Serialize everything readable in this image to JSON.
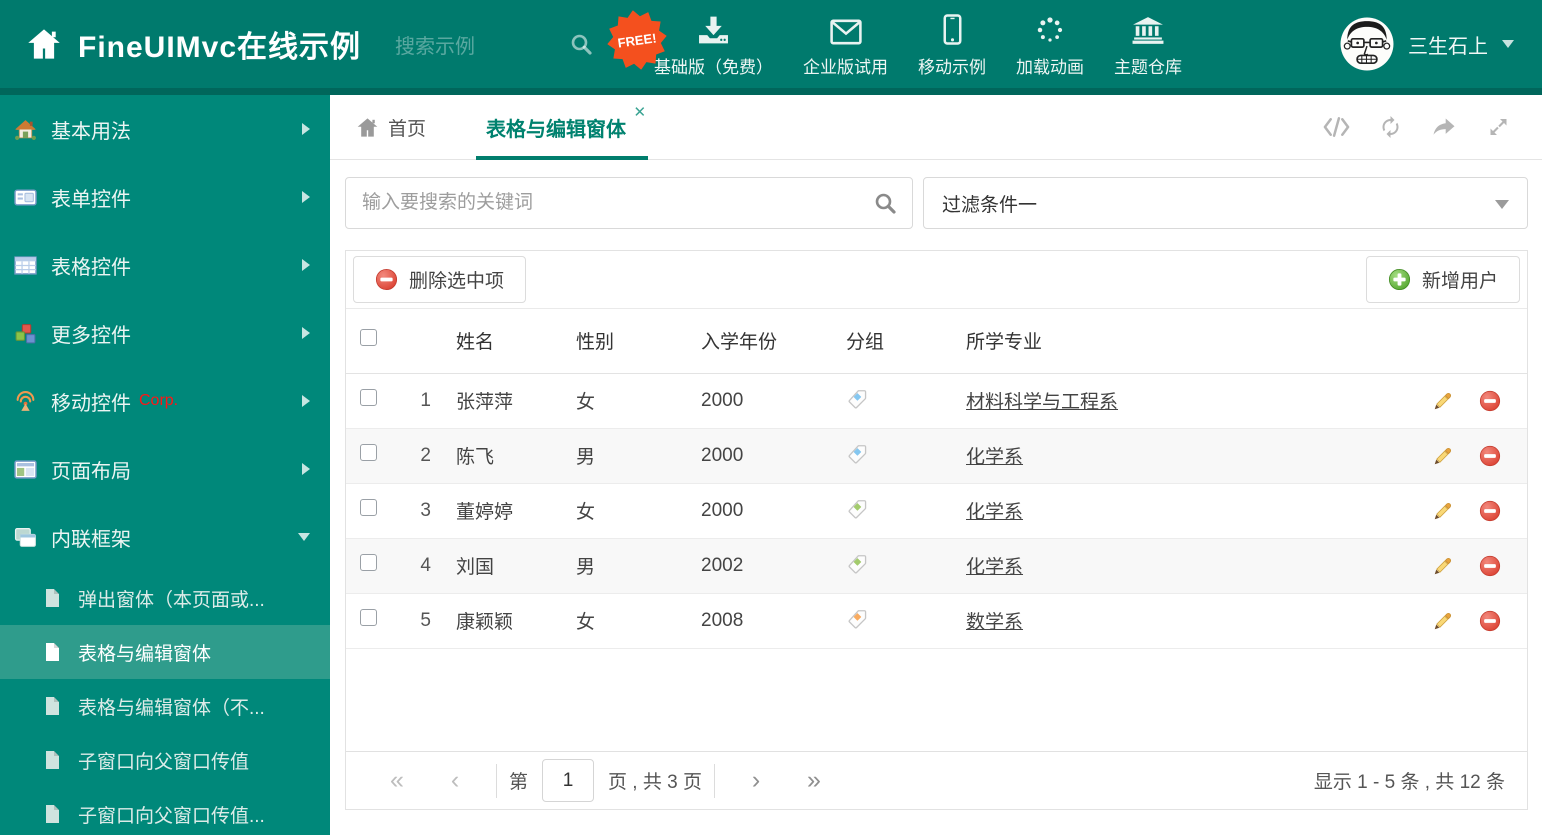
{
  "colors": {
    "header_bg": "#007a6d",
    "header_strip": "#00665b",
    "sidebar_bg": "#00887a",
    "sidebar_active_bg": "#2f9c8c",
    "accent_teal": "#017e6d",
    "free_badge": "#f4501e",
    "corp_badge_text": "#ff1515",
    "tag_blue": "#85c7f0",
    "tag_green": "#a3cb6d",
    "tag_orange": "#f8ab60",
    "delete_red": "#dd4a3c",
    "add_green": "#61b63e",
    "pencil_gold": "#f4cf6b"
  },
  "header": {
    "title": "FineUIMvc在线示例",
    "search_placeholder": "搜索示例",
    "free_badge": "FREE!",
    "nav_items": [
      {
        "label": "基础版（免费）",
        "icon": "download-icon"
      },
      {
        "label": "企业版试用",
        "icon": "envelope-icon"
      },
      {
        "label": "移动示例",
        "icon": "mobile-icon"
      },
      {
        "label": "加载动画",
        "icon": "spinner-icon"
      },
      {
        "label": "主题仓库",
        "icon": "bank-icon"
      }
    ],
    "user": {
      "name": "三生石上"
    }
  },
  "sidebar": {
    "items": [
      {
        "label": "基本用法",
        "icon": "home-icon",
        "caret_class": "caret caret-right"
      },
      {
        "label": "表单控件",
        "icon": "form-icon",
        "caret_class": "caret caret-right"
      },
      {
        "label": "表格控件",
        "icon": "table-icon",
        "caret_class": "caret caret-right"
      },
      {
        "label": "更多控件",
        "icon": "cubes-icon",
        "caret_class": "caret caret-right"
      },
      {
        "label": "移动控件",
        "badge": "Corp.",
        "icon": "antenna-icon",
        "caret_class": "caret caret-right"
      },
      {
        "label": "页面布局",
        "icon": "layout-icon",
        "caret_class": "caret caret-right"
      },
      {
        "label": "内联框架",
        "icon": "frames-icon",
        "caret_class": "caret caret-down",
        "expanded": true
      }
    ],
    "subitems": [
      {
        "label": "弹出窗体（本页面或..."
      },
      {
        "label": "表格与编辑窗体",
        "active": true
      },
      {
        "label": "表格与编辑窗体（不..."
      },
      {
        "label": "子窗口向父窗口传值"
      },
      {
        "label": "子窗口向父窗口传值..."
      }
    ]
  },
  "tabs": [
    {
      "label": "首页",
      "icon": "home-icon"
    },
    {
      "label": "表格与编辑窗体",
      "active": true,
      "closable": true
    }
  ],
  "filters": {
    "search_placeholder": "输入要搜索的关键词",
    "filter_value": "过滤条件一"
  },
  "toolbar": {
    "delete_label": "删除选中项",
    "add_label": "新增用户"
  },
  "table": {
    "headers": [
      "姓名",
      "性别",
      "入学年份",
      "分组",
      "所学专业"
    ],
    "rows": [
      {
        "num": "1",
        "name": "张萍萍",
        "gender": "女",
        "year": "2000",
        "tag_color": "blue",
        "major": "材料科学与工程系"
      },
      {
        "num": "2",
        "name": "陈飞",
        "gender": "男",
        "year": "2000",
        "tag_color": "blue",
        "major": "化学系"
      },
      {
        "num": "3",
        "name": "董婷婷",
        "gender": "女",
        "year": "2000",
        "tag_color": "green",
        "major": "化学系"
      },
      {
        "num": "4",
        "name": "刘国",
        "gender": "男",
        "year": "2002",
        "tag_color": "green",
        "major": "化学系"
      },
      {
        "num": "5",
        "name": "康颖颖",
        "gender": "女",
        "year": "2008",
        "tag_color": "orange",
        "major": "数学系"
      }
    ]
  },
  "pagination": {
    "icons": {
      "first": "«",
      "prev": "‹",
      "next": "›",
      "last": "»"
    },
    "page_prefix": "第",
    "current_page": "1",
    "page_suffix": "页 , 共 3 页",
    "summary": "显示 1 - 5 条 , 共 12 条"
  }
}
